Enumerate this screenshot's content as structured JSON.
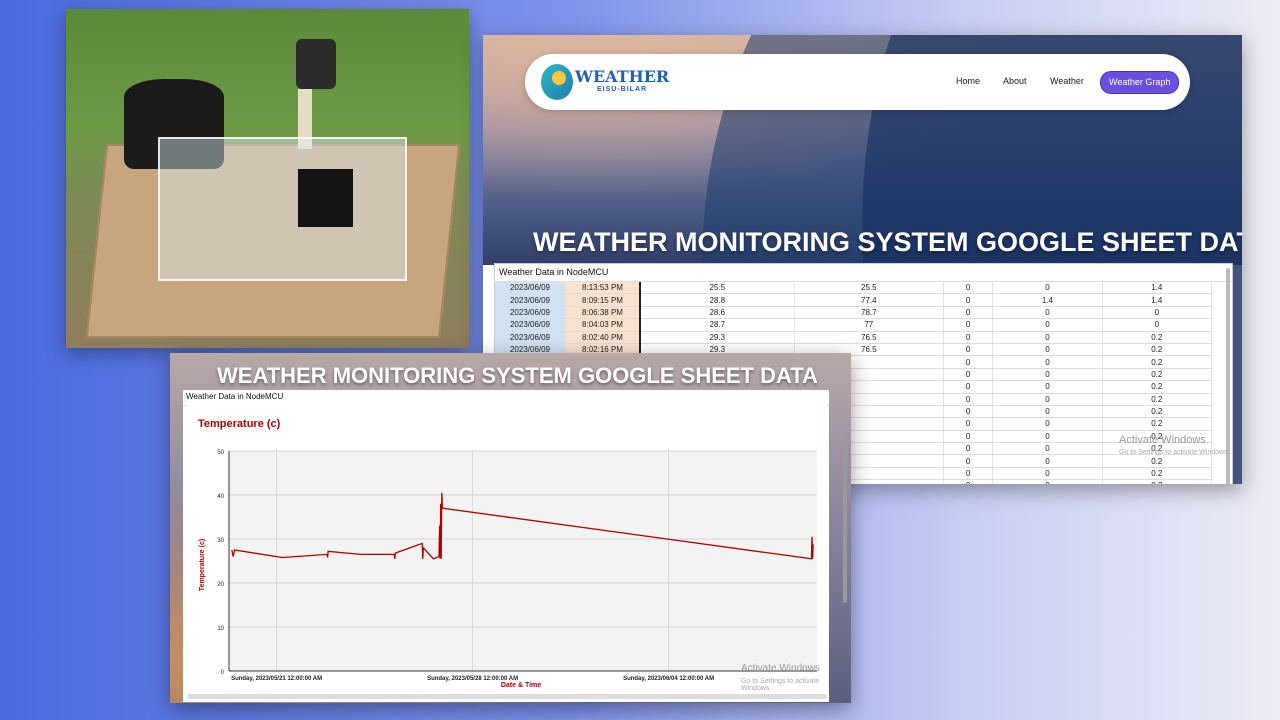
{
  "site": {
    "logo_title": "WEATHER",
    "logo_subtitle": "EISU-BILAR",
    "nav": [
      "Home",
      "About",
      "Weather"
    ],
    "nav_active": "Weather Graph",
    "hero_title": "WEATHER MONITORING SYSTEM GOOGLE SHEET DATA"
  },
  "sheet": {
    "title": "Weather Data in NodeMCU",
    "rows": [
      [
        "2023/06/09",
        "8:13:53 PM",
        "25.5",
        "25.5",
        "0",
        "0",
        "1.4"
      ],
      [
        "2023/06/09",
        "8:09:15 PM",
        "28.8",
        "77.4",
        "0",
        "1.4",
        "1.4"
      ],
      [
        "2023/06/09",
        "8:06:38 PM",
        "28.6",
        "78.7",
        "0",
        "0",
        "0"
      ],
      [
        "2023/06/09",
        "8:04:03 PM",
        "28.7",
        "77",
        "0",
        "0",
        "0"
      ],
      [
        "2023/06/09",
        "8:02:40 PM",
        "29.3",
        "76.5",
        "0",
        "0",
        "0.2"
      ],
      [
        "2023/06/09",
        "8:02:16 PM",
        "29.3",
        "76.5",
        "0",
        "0",
        "0.2"
      ],
      [
        "",
        "",
        "",
        "",
        "0",
        "0",
        "0.2"
      ],
      [
        "",
        "",
        "",
        "",
        "0",
        "0",
        "0.2"
      ],
      [
        "",
        "",
        "",
        "",
        "0",
        "0",
        "0.2"
      ],
      [
        "",
        "",
        "",
        "",
        "0",
        "0",
        "0.2"
      ],
      [
        "",
        "",
        "",
        "",
        "0",
        "0",
        "0.2"
      ],
      [
        "",
        "",
        "",
        "",
        "0",
        "0",
        "0.2"
      ],
      [
        "",
        "",
        "",
        "",
        "0",
        "0",
        "0.2"
      ],
      [
        "",
        "",
        "",
        "",
        "0",
        "0",
        "0.2"
      ],
      [
        "",
        "",
        "",
        "",
        "0",
        "0",
        "0.2"
      ],
      [
        "",
        "",
        "",
        "",
        "0",
        "0",
        "0.2"
      ],
      [
        "",
        "",
        "",
        "",
        "0",
        "0",
        "0.2"
      ]
    ]
  },
  "watermark": {
    "title": "Activate Windows",
    "subtitle": "Go to Settings to activate Windows."
  },
  "chart_panel": {
    "title": "Weather Data in NodeMCU"
  },
  "chart_data": {
    "type": "line",
    "title": "Temperature (c)",
    "xlabel": "Date & Time",
    "ylabel": "Temperature (c)",
    "ylim": [
      0,
      50
    ],
    "yticks": [
      0,
      10,
      20,
      30,
      40,
      50
    ],
    "xticks": [
      "Sunday, 2023/05/21 12:00:00 AM",
      "Sunday, 2023/05/28 12:00:00 AM",
      "Sunday, 2023/06/04 12:00:00 AM"
    ],
    "xlim_days": [
      -1.7,
      19.3
    ],
    "series": [
      {
        "color": "#b00000",
        "points": [
          [
            -1.6,
            27.5
          ],
          [
            -1.55,
            26.0
          ],
          [
            -1.5,
            27.5
          ],
          [
            0.2,
            25.8
          ],
          [
            1.8,
            26.5
          ],
          [
            1.82,
            25.8
          ],
          [
            1.84,
            27.2
          ],
          [
            3.0,
            26.5
          ],
          [
            4.2,
            26.5
          ],
          [
            4.22,
            25.5
          ],
          [
            4.24,
            26.8
          ],
          [
            5.2,
            29.0
          ],
          [
            5.22,
            25.5
          ],
          [
            5.24,
            28.0
          ],
          [
            5.6,
            25.5
          ],
          [
            5.8,
            26.0
          ],
          [
            5.82,
            33.0
          ],
          [
            5.84,
            25.5
          ],
          [
            5.86,
            38.0
          ],
          [
            5.88,
            25.5
          ],
          [
            5.9,
            40.5
          ],
          [
            5.92,
            37.0
          ],
          [
            19.1,
            25.5
          ],
          [
            19.12,
            30.5
          ],
          [
            19.14,
            25.5
          ],
          [
            19.16,
            28.8
          ]
        ]
      }
    ],
    "grid": true
  }
}
